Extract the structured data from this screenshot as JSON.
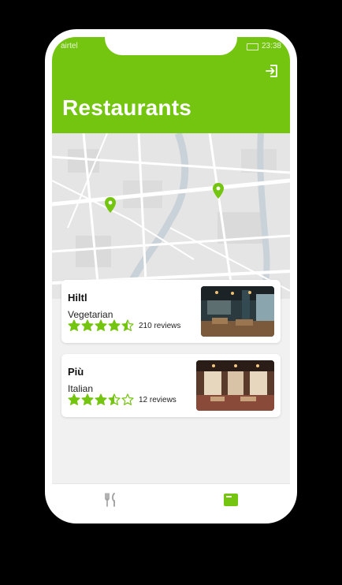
{
  "status_bar": {
    "carrier": "airtel",
    "time": "23:38"
  },
  "header": {
    "title": "Restaurants"
  },
  "restaurants": [
    {
      "name": "Hiltl",
      "category": "Vegetarian",
      "rating": 4.5,
      "reviews": "210 reviews"
    },
    {
      "name": "Più",
      "category": "Italian",
      "rating": 3.5,
      "reviews": "12 reviews"
    }
  ],
  "nav": {
    "tabs": [
      {
        "icon": "fork-knife-icon",
        "active": false
      },
      {
        "icon": "list-card-icon",
        "active": true
      }
    ]
  },
  "colors": {
    "accent": "#74c510",
    "inactive": "#9e9e9e",
    "background": "#f1f1f1"
  }
}
